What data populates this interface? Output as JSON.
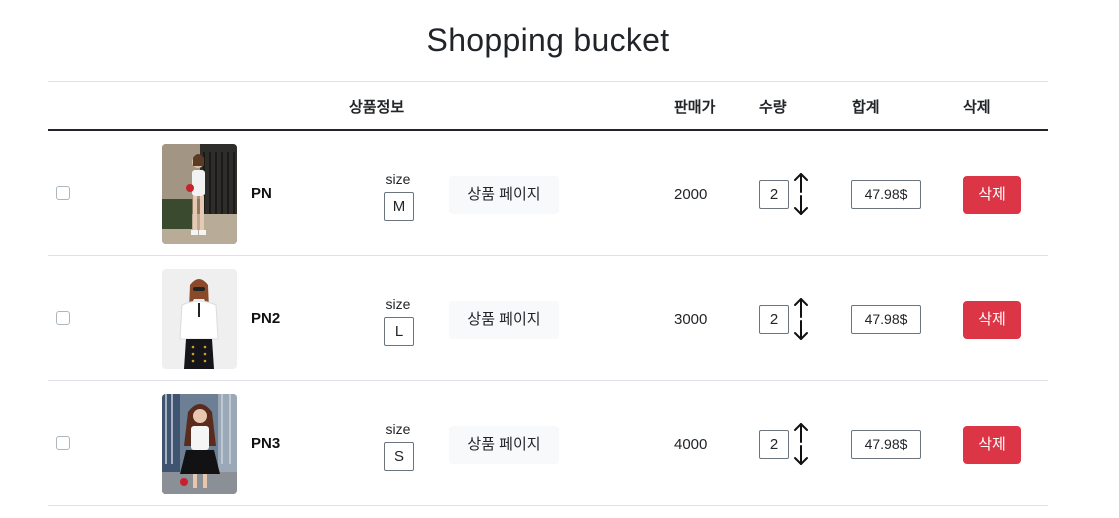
{
  "page": {
    "title": "Shopping bucket"
  },
  "table": {
    "headers": {
      "product_info": "상품정보",
      "price": "판매가",
      "quantity": "수량",
      "total": "합계",
      "delete": "삭제"
    },
    "rows": [
      {
        "name": "PN",
        "size_label": "size",
        "size": "M",
        "page_button": "상품 페이지",
        "price": "2000",
        "quantity": "2",
        "total": "47.98$",
        "delete_button": "삭제",
        "checked": false
      },
      {
        "name": "PN2",
        "size_label": "size",
        "size": "L",
        "page_button": "상품 페이지",
        "price": "3000",
        "quantity": "2",
        "total": "47.98$",
        "delete_button": "삭제",
        "checked": false
      },
      {
        "name": "PN3",
        "size_label": "size",
        "size": "S",
        "page_button": "상품 페이지",
        "price": "4000",
        "quantity": "2",
        "total": "47.98$",
        "delete_button": "삭제",
        "checked": false
      }
    ]
  },
  "icons": {
    "increase": "arrow-up-icon",
    "decrease": "arrow-down-icon"
  },
  "colors": {
    "delete_button": "#dc3545",
    "page_button_bg": "#f8f9fa",
    "header_rule": "#212529",
    "row_rule": "#dee2e6"
  }
}
